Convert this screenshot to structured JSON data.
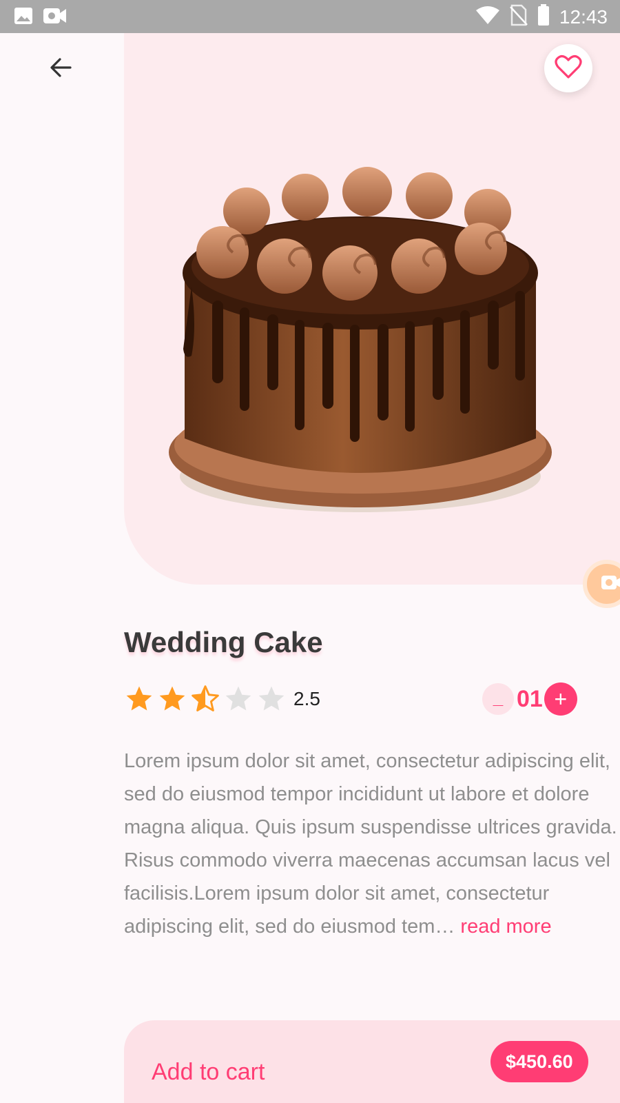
{
  "status_bar": {
    "time": "12:43",
    "icons": [
      "image-icon",
      "video-camera-icon",
      "wifi-icon",
      "no-sim-icon",
      "battery-icon"
    ]
  },
  "nav": {
    "back_icon": "arrow-left-icon"
  },
  "hero": {
    "favorite_icon": "heart-outline-icon",
    "image_subject": "chocolate-drip-cake",
    "side_fab_icon": "video-camera-icon"
  },
  "product": {
    "title": "Wedding Cake",
    "rating": {
      "value_text": "2.5",
      "value": 2.5,
      "max": 5
    },
    "quantity": {
      "minus_label": "_",
      "value": "01",
      "plus_label": "+"
    },
    "description": "Lorem ipsum dolor sit amet, consectetur adipiscing elit, sed do eiusmod tempor incididunt ut labore et dolore magna aliqua. Quis ipsum suspendisse ultrices gravida. Risus commodo viverra maecenas accumsan lacus vel facilisis.Lorem ipsum dolor sit amet, consectetur adipiscing elit, sed do eiusmod tem…",
    "read_more": "read more"
  },
  "cart": {
    "label": "Add to cart",
    "price": "$450.60"
  },
  "colors": {
    "accent": "#ff3d74",
    "hero_bg": "#fdebee",
    "star_filled": "#ff9a1f",
    "star_empty": "#e0e0e0",
    "status_bar": "#a9a9a9"
  }
}
